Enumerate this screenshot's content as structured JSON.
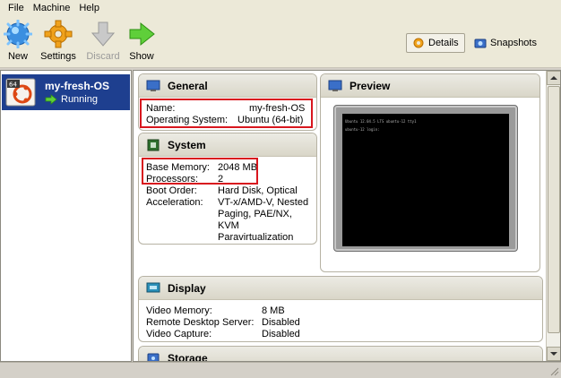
{
  "menu": {
    "file": "File",
    "machine": "Machine",
    "help": "Help"
  },
  "toolbar": {
    "new": "New",
    "settings": "Settings",
    "discard": "Discard",
    "show": "Show",
    "details": "Details",
    "snapshots": "Snapshots"
  },
  "vm": {
    "badge": "64",
    "name": "my-fresh-OS",
    "state": "Running"
  },
  "general": {
    "title": "General",
    "name_label": "Name:",
    "name_value": "my-fresh-OS",
    "os_label": "Operating System:",
    "os_value": "Ubuntu (64-bit)"
  },
  "system": {
    "title": "System",
    "mem_label": "Base Memory:",
    "mem_value": "2048 MB",
    "cpu_label": "Processors:",
    "cpu_value": "2",
    "boot_label": "Boot Order:",
    "boot_value": "Hard Disk, Optical",
    "accel_label": "Acceleration:",
    "accel_value": "VT-x/AMD-V, Nested\nPaging, PAE/NX,\nKVM\nParavirtualization"
  },
  "preview": {
    "title": "Preview",
    "line1": "Ubuntu 12.04.5 LTS ubuntu-12 tty1",
    "line2": "ubuntu-12 login:"
  },
  "display": {
    "title": "Display",
    "vmem_label": "Video Memory:",
    "vmem_value": "8 MB",
    "rds_label": "Remote Desktop Server:",
    "rds_value": "Disabled",
    "cap_label": "Video Capture:",
    "cap_value": "Disabled"
  },
  "storage": {
    "title": "Storage"
  },
  "colors": {
    "selection": "#1e3f8f",
    "highlight": "#d8161e"
  }
}
